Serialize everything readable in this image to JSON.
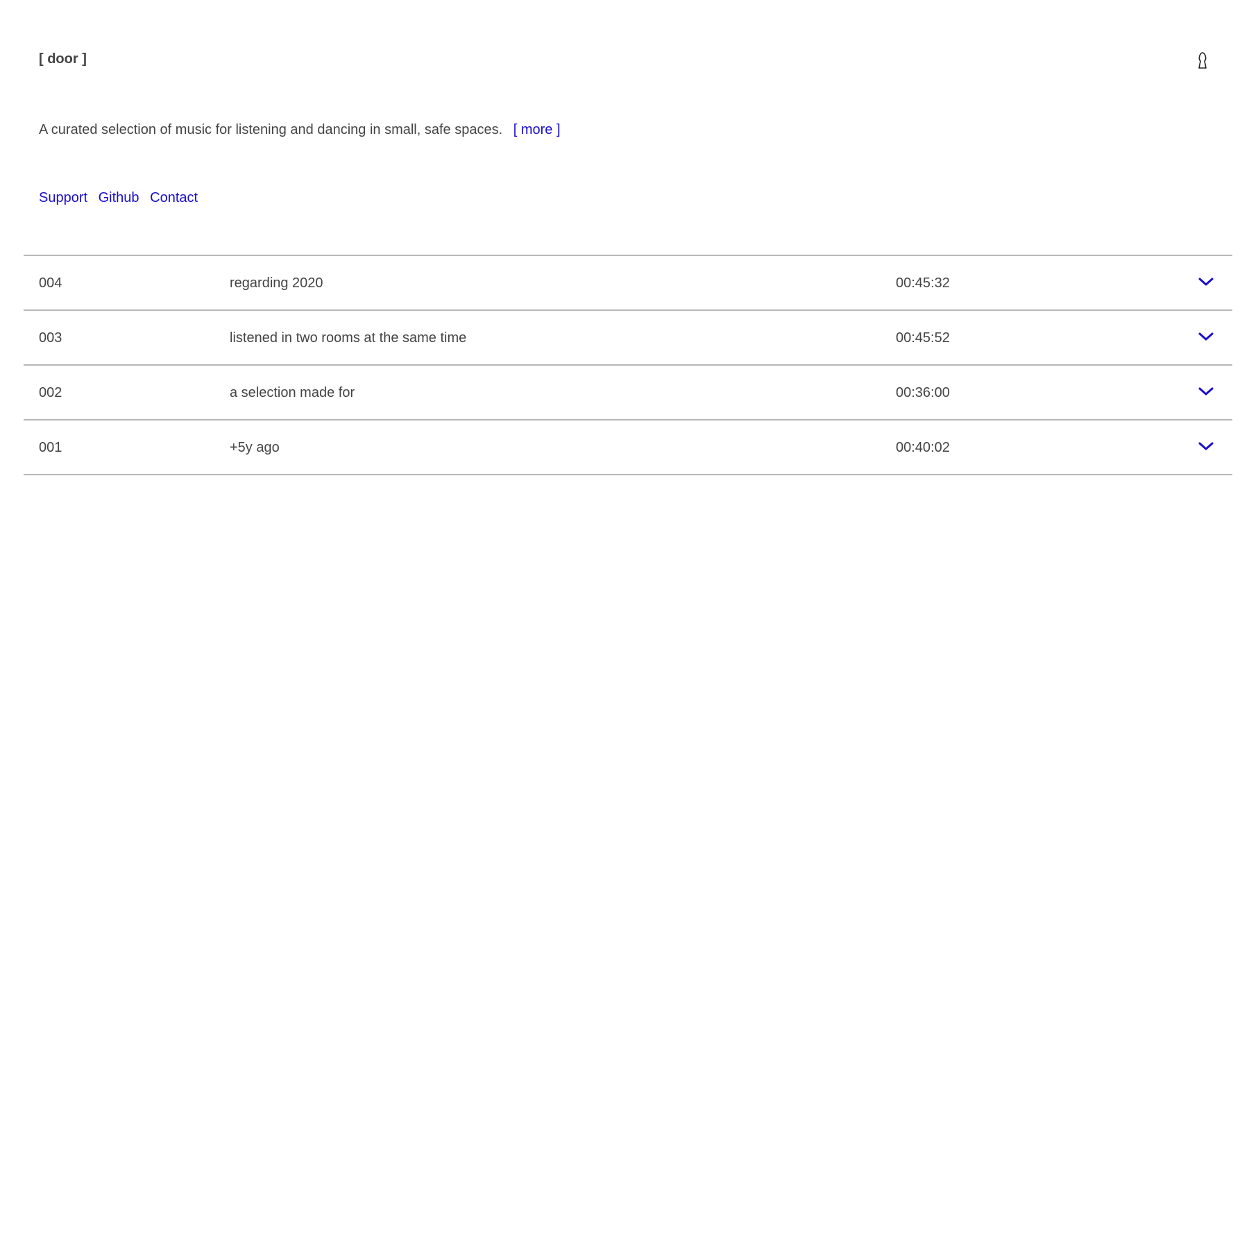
{
  "header": {
    "brand": "[ door ]",
    "right_icon": "door-keyhole-icon"
  },
  "intro": {
    "text": "A curated selection of music for listening and dancing in small, safe spaces.",
    "more_label": "[ more ]"
  },
  "links": [
    {
      "label": "Support"
    },
    {
      "label": "Github"
    },
    {
      "label": "Contact"
    }
  ],
  "tracks": [
    {
      "num": "004",
      "title": "regarding 2020",
      "duration": "00:45:32",
      "icon": "chevron-down-icon"
    },
    {
      "num": "003",
      "title": "listened in two rooms at the same time",
      "duration": "00:45:52",
      "icon": "chevron-down-icon"
    },
    {
      "num": "002",
      "title": "a selection made for",
      "duration": "00:36:00",
      "icon": "chevron-down-icon"
    },
    {
      "num": "001",
      "title": "+5y ago",
      "duration": "00:40:02",
      "icon": "chevron-down-icon"
    }
  ],
  "colors": {
    "text": "#444444",
    "link": "#1a0dcc",
    "divider": "#b7b7b7",
    "background": "#ffffff"
  }
}
